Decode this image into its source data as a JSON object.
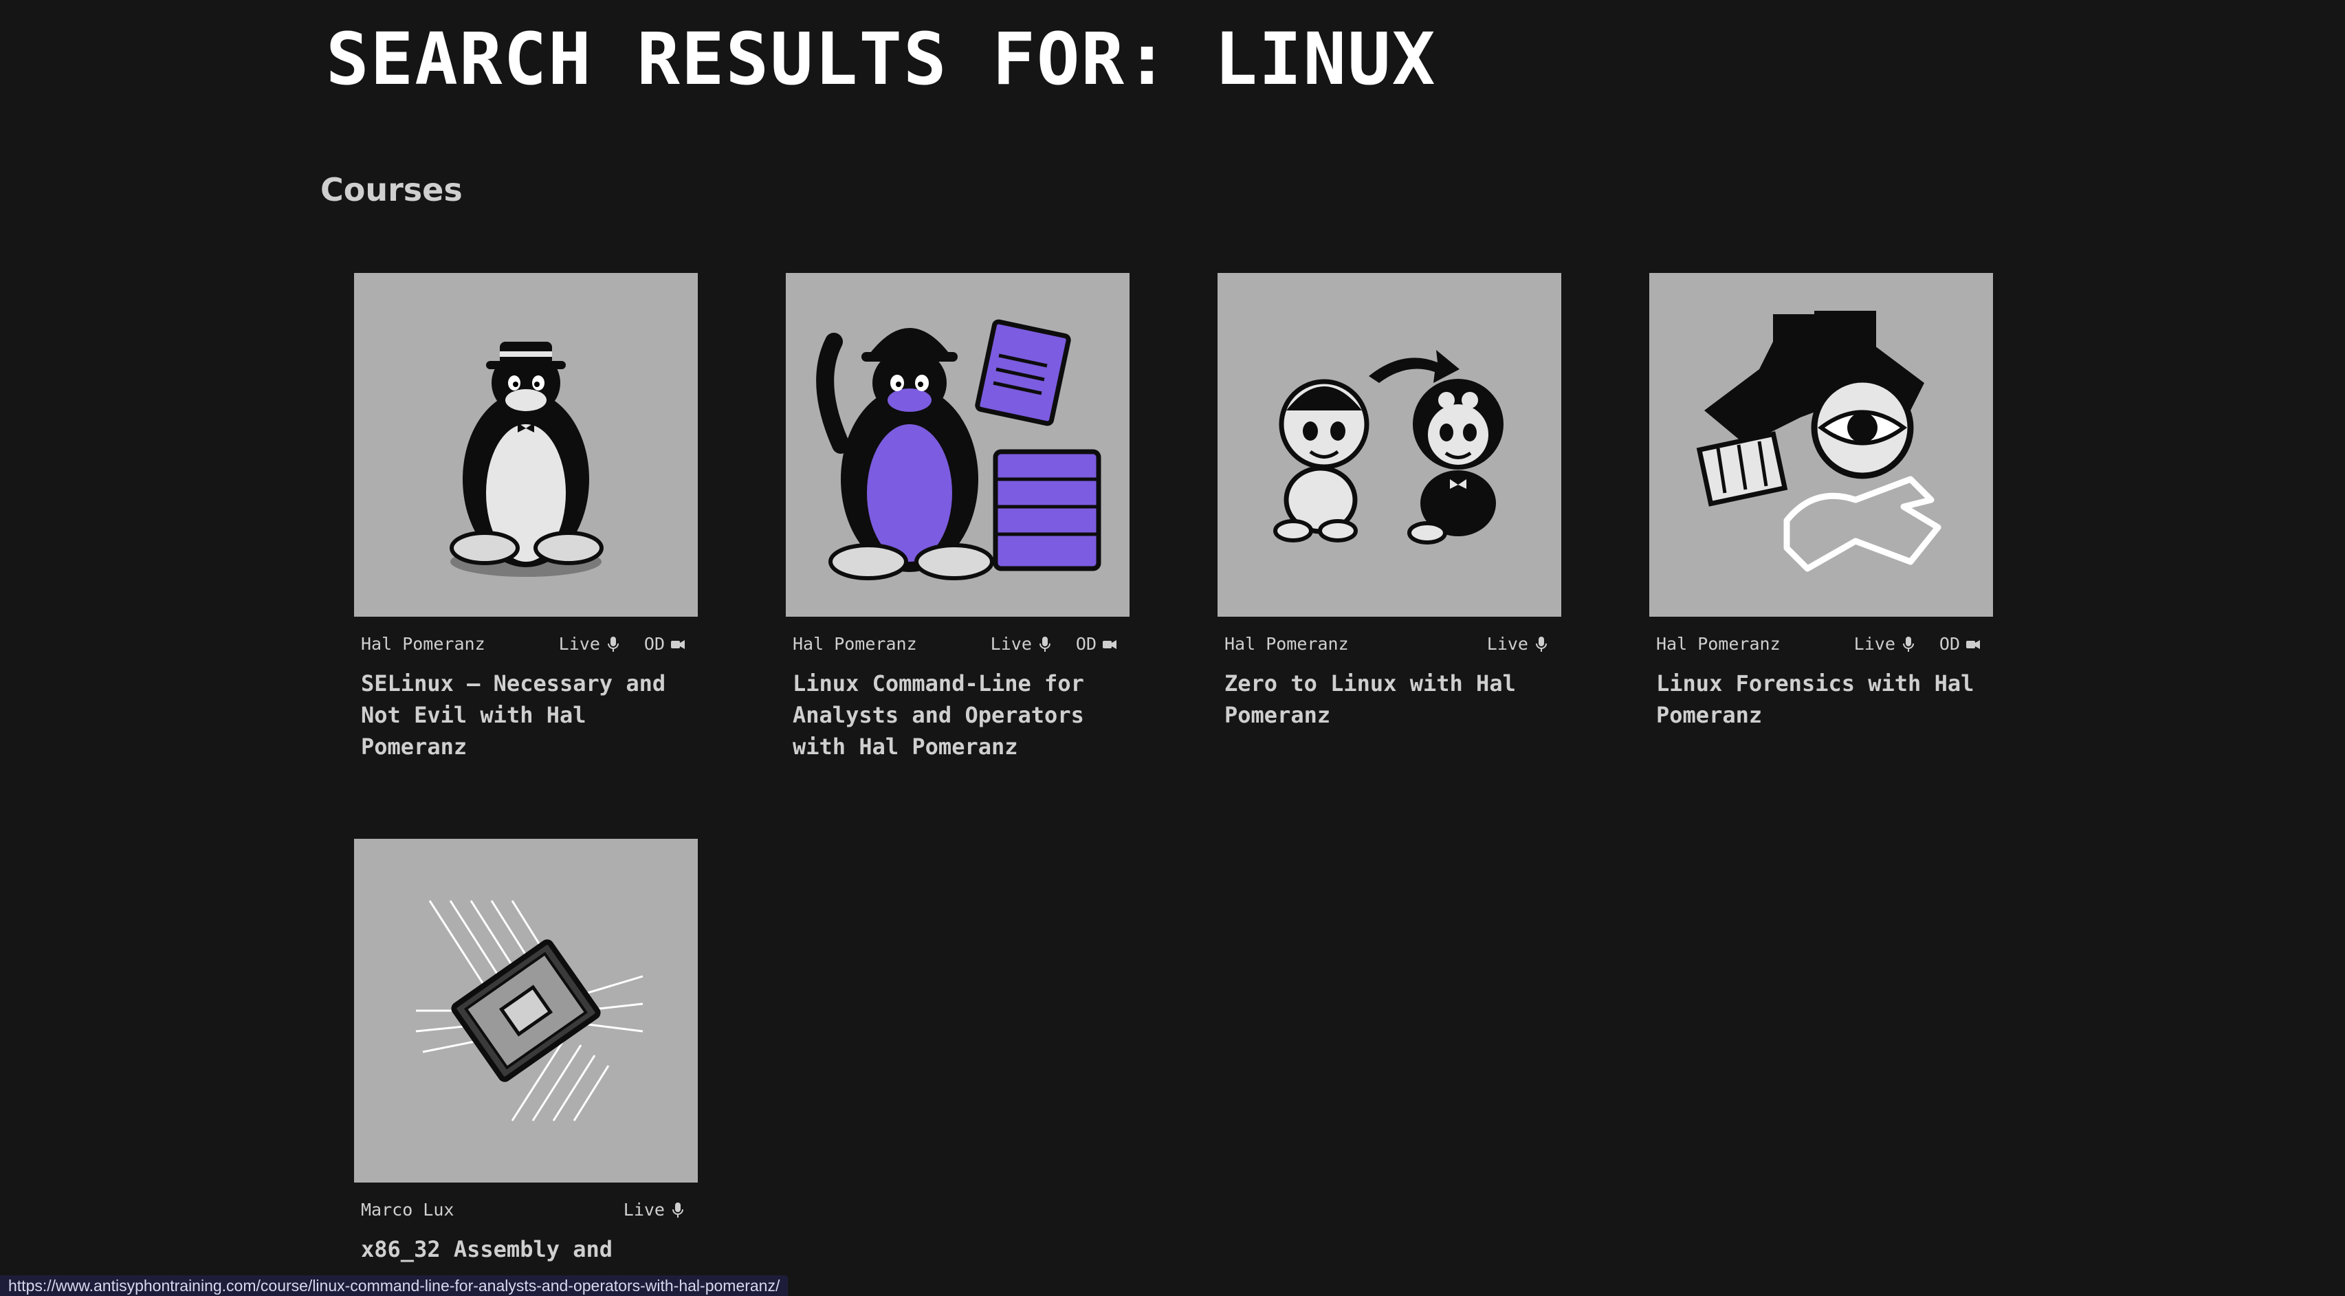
{
  "header": {
    "title": "SEARCH RESULTS FOR: LINUX"
  },
  "courses_section": {
    "heading": "Courses",
    "cards": [
      {
        "author": "Hal Pomeranz",
        "live_label": "Live",
        "od_label": "OD",
        "title": "SELinux – Necessary and Not Evil with Hal Pomeranz",
        "image_icon": "penguin-with-hat-icon"
      },
      {
        "author": "Hal Pomeranz",
        "live_label": "Live",
        "od_label": "OD",
        "title": "Linux Command-Line for Analysts and Operators with Hal Pomeranz",
        "image_icon": "penguin-with-documents-icon"
      },
      {
        "author": "Hal Pomeranz",
        "live_label": "Live",
        "title": "Zero to Linux with Hal Pomeranz",
        "image_icon": "babies-illustration-icon"
      },
      {
        "author": "Hal Pomeranz",
        "live_label": "Live",
        "od_label": "OD",
        "title": "Linux Forensics with Hal Pomeranz",
        "image_icon": "detective-eye-icon"
      },
      {
        "author": "Marco Lux",
        "live_label": "Live",
        "title": "x86_32 Assembly and",
        "image_icon": "cpu-chip-icon"
      }
    ]
  },
  "status_bar": {
    "url": "https://www.antisyphontraining.com/course/linux-command-line-for-analysts-and-operators-with-hal-pomeranz/"
  },
  "colors": {
    "background": "#151515",
    "card_image_bg": "#aeaeae",
    "accent_purple": "#7c5ce0",
    "text": "#cfcfcf"
  }
}
